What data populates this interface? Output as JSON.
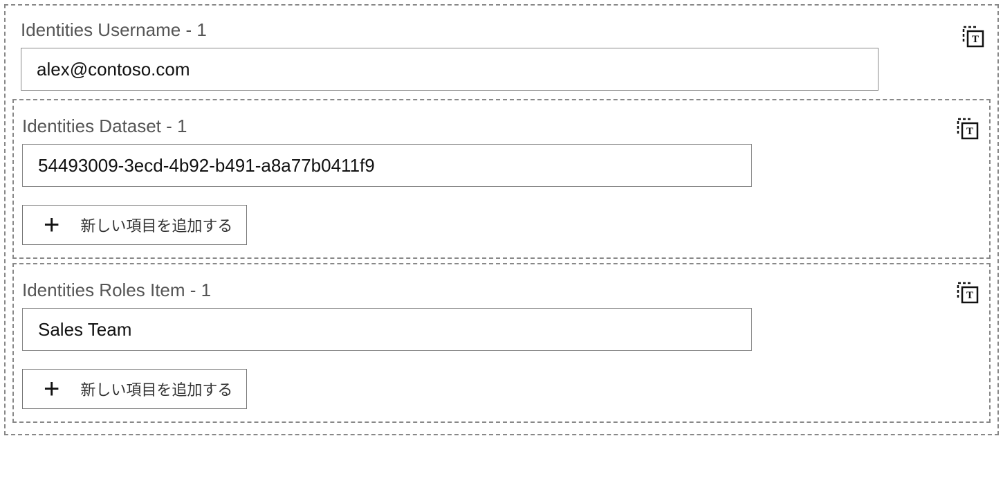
{
  "username": {
    "label": "Identities Username - 1",
    "value": "alex@contoso.com"
  },
  "dataset": {
    "label": "Identities Dataset - 1",
    "value": "54493009-3ecd-4b92-b491-a8a77b0411f9",
    "add_label": "新しい項目を追加する"
  },
  "roles": {
    "label": "Identities Roles Item - 1",
    "value": "Sales Team",
    "add_label": "新しい項目を追加する"
  }
}
